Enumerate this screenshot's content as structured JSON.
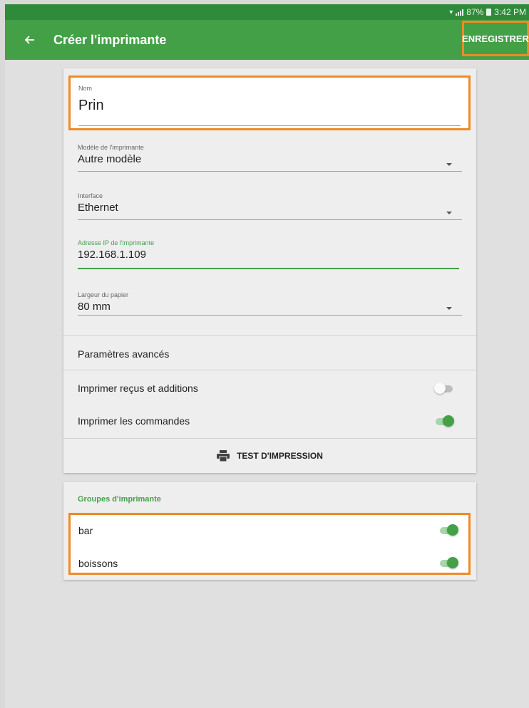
{
  "status": {
    "battery": "87%",
    "time": "3:42 PM"
  },
  "appbar": {
    "title": "Créer l'imprimante",
    "save_label": "ENREGISTRER"
  },
  "form": {
    "name": {
      "label": "Nom",
      "value": "Prin"
    },
    "model": {
      "label": "Modèle de l'imprimante",
      "value": "Autre modèle"
    },
    "interface": {
      "label": "Interface",
      "value": "Ethernet"
    },
    "ip": {
      "label": "Adresse IP de l'imprimante",
      "value": "192.168.1.109"
    },
    "paper": {
      "label": "Largeur du papier",
      "value": "80 mm"
    }
  },
  "advanced": {
    "title": "Paramètres avancés",
    "print_receipts": {
      "label": "Imprimer reçus et additions",
      "enabled": false
    },
    "print_orders": {
      "label": "Imprimer les commandes",
      "enabled": true
    }
  },
  "test_print_label": "TEST D'IMPRESSION",
  "groups": {
    "title": "Groupes d'imprimante",
    "items": [
      {
        "label": "bar",
        "enabled": true
      },
      {
        "label": "boissons",
        "enabled": true
      }
    ]
  },
  "colors": {
    "primary": "#43a047",
    "statusbar": "#2e8b3a",
    "highlight": "#f08a24"
  }
}
